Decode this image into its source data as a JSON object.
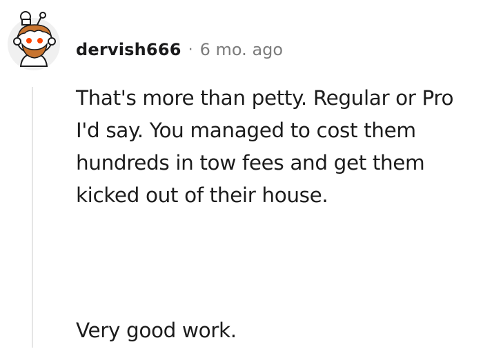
{
  "comment": {
    "avatar_icon": "snoo-avatar-icon",
    "author": "dervish666",
    "separator": "·",
    "timestamp": "6 mo. ago",
    "body_line_1": "That's more than petty. Regular or Pro I'd say. You managed to cost them hundreds in tow fees and get them kicked out of their house.",
    "body_line_2": "Very good work."
  },
  "colors": {
    "author": "#1a1a1b",
    "meta": "#7c7c7c",
    "text": "#1c1c1c",
    "thread_line": "#e5e5e5",
    "avatar_hair": "#c8742f",
    "avatar_eye": "#ff4500"
  }
}
